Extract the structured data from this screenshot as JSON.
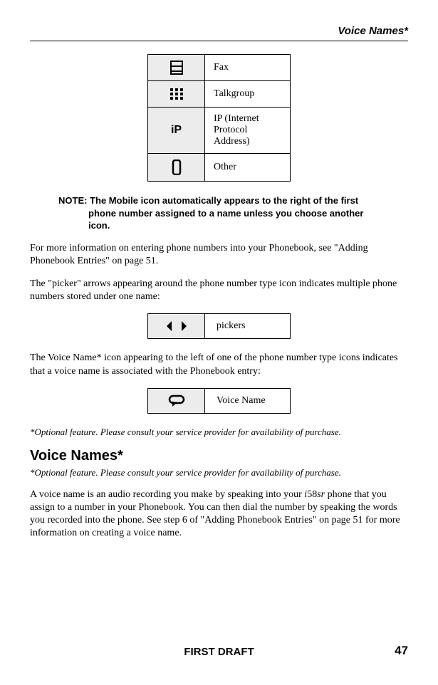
{
  "header": {
    "running_title": "Voice Names*"
  },
  "icon_table": [
    {
      "icon_name": "fax-icon",
      "label": "Fax"
    },
    {
      "icon_name": "talkgroup-icon",
      "label": "Talkgroup"
    },
    {
      "icon_name": "ip-icon",
      "icon_text": "iP",
      "label": "IP (Internet Protocol Address)"
    },
    {
      "icon_name": "other-icon",
      "label": "Other"
    }
  ],
  "note": {
    "prefix": "NOTE:",
    "text": "The Mobile icon automatically appears to the right of the first phone number assigned to a name unless you choose another icon."
  },
  "para1": "For more information on entering phone numbers into your Phonebook, see \"Adding Phonebook Entries\" on page 51.",
  "para2": "The \"picker\" arrows appearing around the phone number type icon indicates multiple phone numbers stored under one name:",
  "pickers_table": {
    "icon_name": "pickers-icon",
    "label": "pickers"
  },
  "para3": "The Voice Name* icon appearing to the left of one of the phone number type icons indicates that a voice name is associated with the Phonebook entry:",
  "voicename_table": {
    "icon_name": "voice-name-icon",
    "label": "Voice Name"
  },
  "footnote1": "*Optional feature. Please consult your service provider for availability of purchase.",
  "section_heading": "Voice Names*",
  "footnote2": "*Optional feature. Please consult your service provider for availability of purchase.",
  "para4_a": "A voice name is an audio recording you make by speaking into your ",
  "para4_model": "i58sr",
  "para4_b": " phone that you assign to a number in your Phonebook. You can then dial the number by speaking the words you recorded into the phone. See step 6 of \"Adding Phonebook Entries\" on page 51 for more information on creating a voice name.",
  "footer": {
    "draft_text": "FIRST DRAFT",
    "page_number": "47"
  }
}
